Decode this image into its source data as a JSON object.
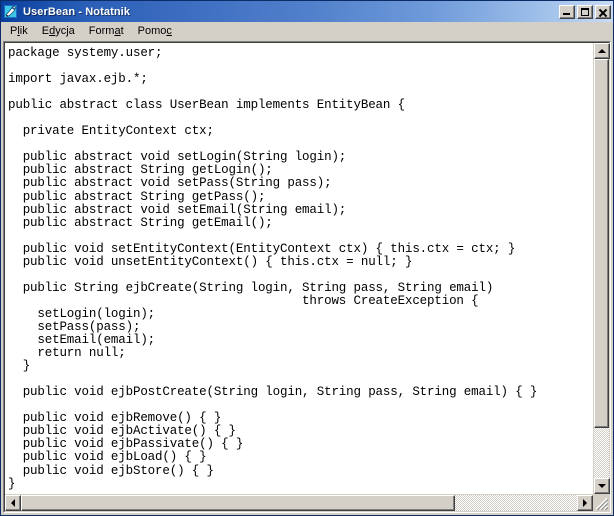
{
  "window": {
    "title": "UserBean - Notatnik",
    "icon": "notepad-icon",
    "buttons": {
      "minimize": "Minimalizuj",
      "maximize": "Maksymalizuj",
      "close": "Zamknij"
    }
  },
  "menu": {
    "items": [
      {
        "label": "Plik",
        "pre": "P",
        "mnemonic": "l",
        "post": "ik"
      },
      {
        "label": "Edycja",
        "pre": "E",
        "mnemonic": "d",
        "post": "ycja"
      },
      {
        "label": "Format",
        "pre": "Form",
        "mnemonic": "a",
        "post": "t"
      },
      {
        "label": "Pomoc",
        "pre": "Pomo",
        "mnemonic": "c",
        "post": ""
      }
    ]
  },
  "editor": {
    "content": "package systemy.user;\n\nimport javax.ejb.*;\n\npublic abstract class UserBean implements EntityBean {\n\n  private EntityContext ctx;\n\n  public abstract void setLogin(String login);\n  public abstract String getLogin();\n  public abstract void setPass(String pass);\n  public abstract String getPass();\n  public abstract void setEmail(String email);\n  public abstract String getEmail();\n\n  public void setEntityContext(EntityContext ctx) { this.ctx = ctx; }\n  public void unsetEntityContext() { this.ctx = null; }\n\n  public String ejbCreate(String login, String pass, String email)\n                                        throws CreateException {\n    setLogin(login);\n    setPass(pass);\n    setEmail(email);\n    return null;\n  }\n\n  public void ejbPostCreate(String login, String pass, String email) { }\n\n  public void ejbRemove() { }\n  public void ejbActivate() { }\n  public void ejbPassivate() { }\n  public void ejbLoad() { }\n  public void ejbStore() { }\n}"
  },
  "scrollbars": {
    "vertical": {
      "thumb_percent": 88,
      "up_icon": "arrow-up-icon",
      "down_icon": "arrow-down-icon"
    },
    "horizontal": {
      "thumb_percent": 78,
      "left_icon": "arrow-left-icon",
      "right_icon": "arrow-right-icon"
    },
    "resize_grip": "resize-grip-icon"
  },
  "colors": {
    "titlebar_start": "#0b3f9e",
    "titlebar_end": "#c9dcf4",
    "face": "#d4d0c8",
    "editor_bg": "#ffffff",
    "text": "#000000"
  }
}
